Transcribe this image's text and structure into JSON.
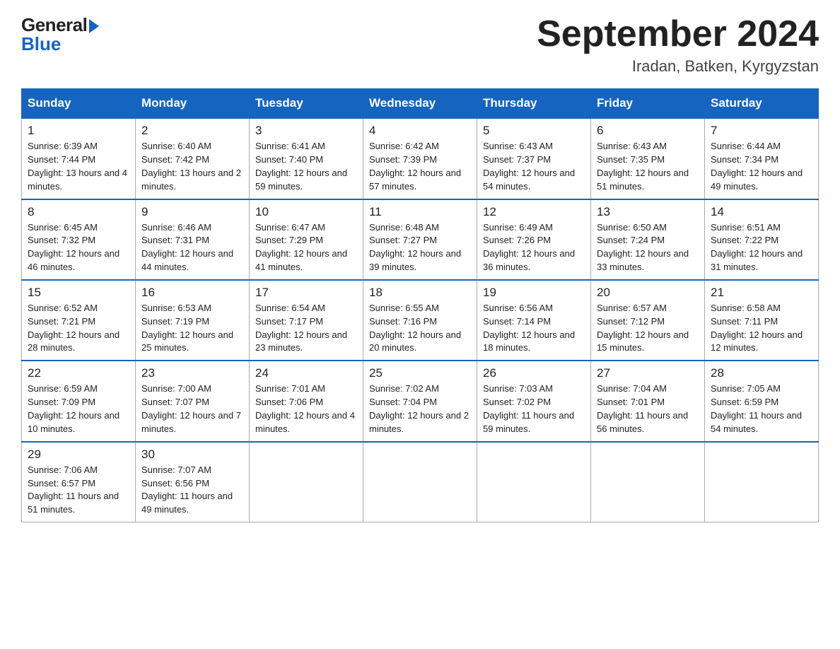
{
  "header": {
    "logo_general": "General",
    "logo_blue": "Blue",
    "month_year": "September 2024",
    "location": "Iradan, Batken, Kyrgyzstan"
  },
  "weekdays": [
    "Sunday",
    "Monday",
    "Tuesday",
    "Wednesday",
    "Thursday",
    "Friday",
    "Saturday"
  ],
  "weeks": [
    [
      {
        "day": "1",
        "sunrise": "6:39 AM",
        "sunset": "7:44 PM",
        "daylight": "13 hours and 4 minutes."
      },
      {
        "day": "2",
        "sunrise": "6:40 AM",
        "sunset": "7:42 PM",
        "daylight": "13 hours and 2 minutes."
      },
      {
        "day": "3",
        "sunrise": "6:41 AM",
        "sunset": "7:40 PM",
        "daylight": "12 hours and 59 minutes."
      },
      {
        "day": "4",
        "sunrise": "6:42 AM",
        "sunset": "7:39 PM",
        "daylight": "12 hours and 57 minutes."
      },
      {
        "day": "5",
        "sunrise": "6:43 AM",
        "sunset": "7:37 PM",
        "daylight": "12 hours and 54 minutes."
      },
      {
        "day": "6",
        "sunrise": "6:43 AM",
        "sunset": "7:35 PM",
        "daylight": "12 hours and 51 minutes."
      },
      {
        "day": "7",
        "sunrise": "6:44 AM",
        "sunset": "7:34 PM",
        "daylight": "12 hours and 49 minutes."
      }
    ],
    [
      {
        "day": "8",
        "sunrise": "6:45 AM",
        "sunset": "7:32 PM",
        "daylight": "12 hours and 46 minutes."
      },
      {
        "day": "9",
        "sunrise": "6:46 AM",
        "sunset": "7:31 PM",
        "daylight": "12 hours and 44 minutes."
      },
      {
        "day": "10",
        "sunrise": "6:47 AM",
        "sunset": "7:29 PM",
        "daylight": "12 hours and 41 minutes."
      },
      {
        "day": "11",
        "sunrise": "6:48 AM",
        "sunset": "7:27 PM",
        "daylight": "12 hours and 39 minutes."
      },
      {
        "day": "12",
        "sunrise": "6:49 AM",
        "sunset": "7:26 PM",
        "daylight": "12 hours and 36 minutes."
      },
      {
        "day": "13",
        "sunrise": "6:50 AM",
        "sunset": "7:24 PM",
        "daylight": "12 hours and 33 minutes."
      },
      {
        "day": "14",
        "sunrise": "6:51 AM",
        "sunset": "7:22 PM",
        "daylight": "12 hours and 31 minutes."
      }
    ],
    [
      {
        "day": "15",
        "sunrise": "6:52 AM",
        "sunset": "7:21 PM",
        "daylight": "12 hours and 28 minutes."
      },
      {
        "day": "16",
        "sunrise": "6:53 AM",
        "sunset": "7:19 PM",
        "daylight": "12 hours and 25 minutes."
      },
      {
        "day": "17",
        "sunrise": "6:54 AM",
        "sunset": "7:17 PM",
        "daylight": "12 hours and 23 minutes."
      },
      {
        "day": "18",
        "sunrise": "6:55 AM",
        "sunset": "7:16 PM",
        "daylight": "12 hours and 20 minutes."
      },
      {
        "day": "19",
        "sunrise": "6:56 AM",
        "sunset": "7:14 PM",
        "daylight": "12 hours and 18 minutes."
      },
      {
        "day": "20",
        "sunrise": "6:57 AM",
        "sunset": "7:12 PM",
        "daylight": "12 hours and 15 minutes."
      },
      {
        "day": "21",
        "sunrise": "6:58 AM",
        "sunset": "7:11 PM",
        "daylight": "12 hours and 12 minutes."
      }
    ],
    [
      {
        "day": "22",
        "sunrise": "6:59 AM",
        "sunset": "7:09 PM",
        "daylight": "12 hours and 10 minutes."
      },
      {
        "day": "23",
        "sunrise": "7:00 AM",
        "sunset": "7:07 PM",
        "daylight": "12 hours and 7 minutes."
      },
      {
        "day": "24",
        "sunrise": "7:01 AM",
        "sunset": "7:06 PM",
        "daylight": "12 hours and 4 minutes."
      },
      {
        "day": "25",
        "sunrise": "7:02 AM",
        "sunset": "7:04 PM",
        "daylight": "12 hours and 2 minutes."
      },
      {
        "day": "26",
        "sunrise": "7:03 AM",
        "sunset": "7:02 PM",
        "daylight": "11 hours and 59 minutes."
      },
      {
        "day": "27",
        "sunrise": "7:04 AM",
        "sunset": "7:01 PM",
        "daylight": "11 hours and 56 minutes."
      },
      {
        "day": "28",
        "sunrise": "7:05 AM",
        "sunset": "6:59 PM",
        "daylight": "11 hours and 54 minutes."
      }
    ],
    [
      {
        "day": "29",
        "sunrise": "7:06 AM",
        "sunset": "6:57 PM",
        "daylight": "11 hours and 51 minutes."
      },
      {
        "day": "30",
        "sunrise": "7:07 AM",
        "sunset": "6:56 PM",
        "daylight": "11 hours and 49 minutes."
      },
      null,
      null,
      null,
      null,
      null
    ]
  ]
}
